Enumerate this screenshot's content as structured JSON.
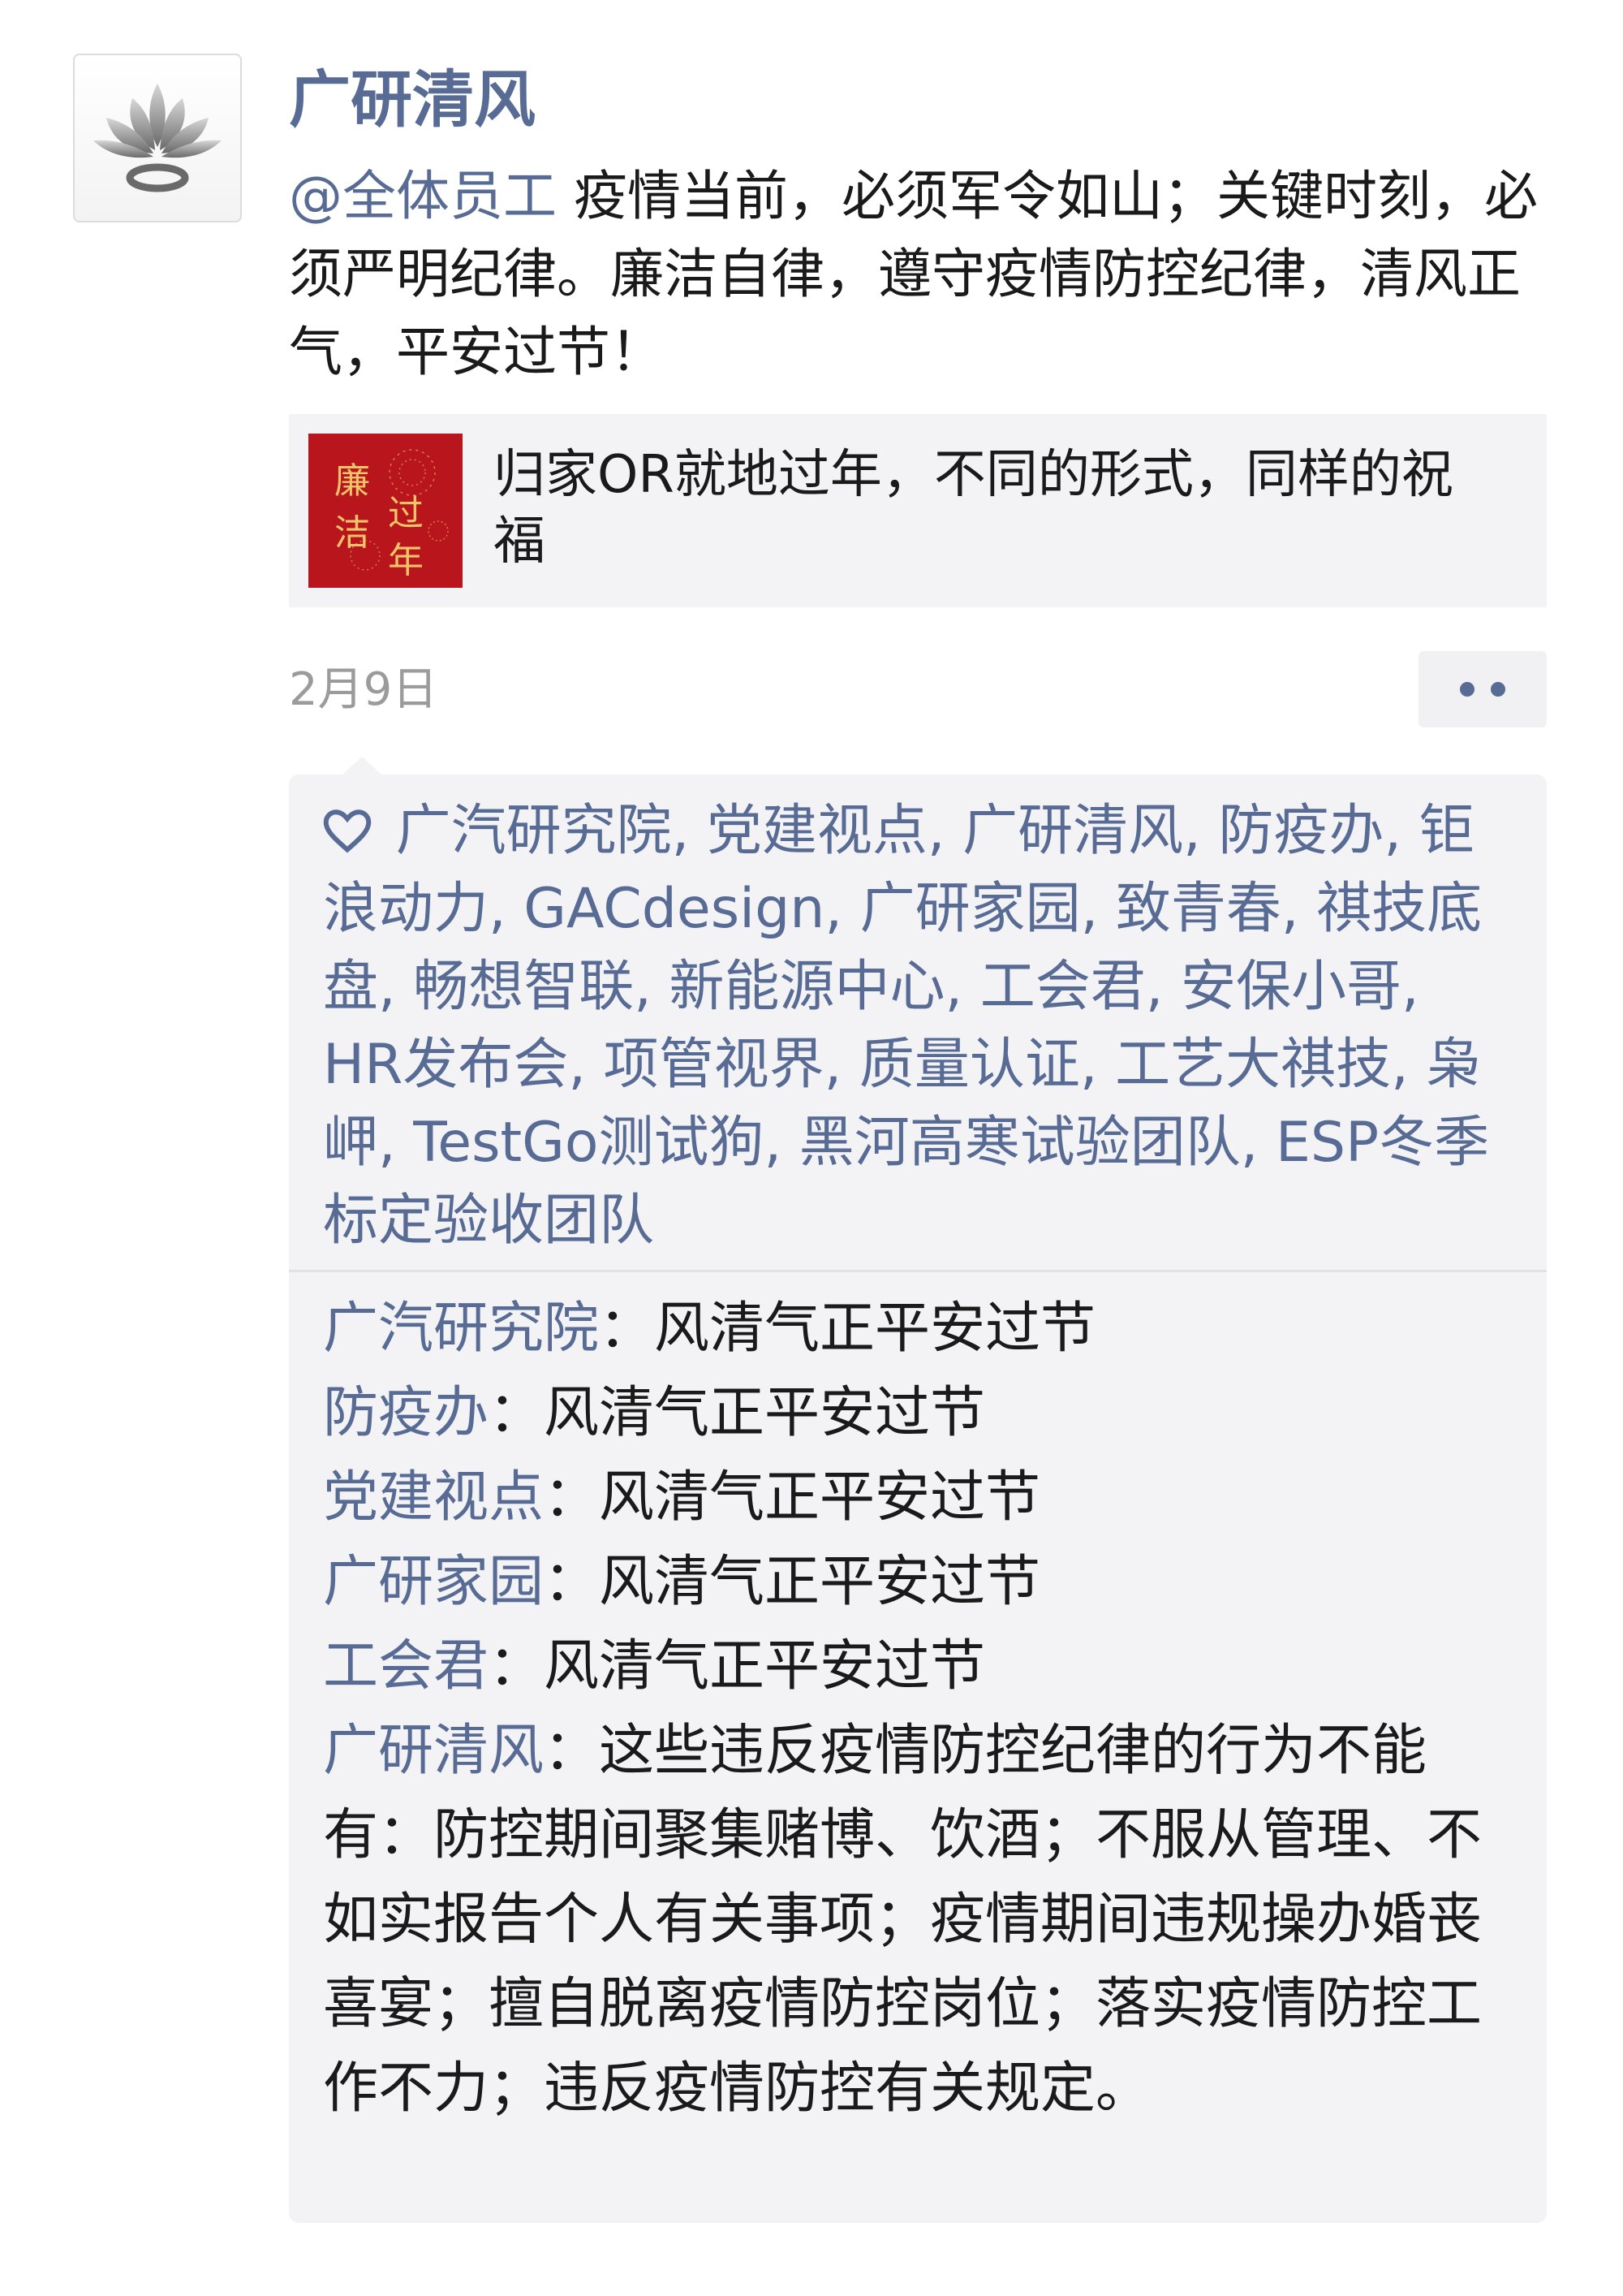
{
  "author": {
    "name": "广研清风"
  },
  "post": {
    "mention": "@全体员工",
    "text": " 疫情当前，必须军令如山；关键时刻，必须严明纪律。廉洁自律，遵守疫情防控纪律，清风正气，平安过节！"
  },
  "link_card": {
    "title": "归家OR就地过年，不同的形式，同样的祝福",
    "thumbnail_text": [
      "廉",
      "洁",
      "过",
      "年"
    ]
  },
  "meta": {
    "date": "2月9日"
  },
  "likes": {
    "icon": "heart-icon",
    "names": [
      "广汽研究院",
      "党建视点",
      "广研清风",
      "防疫办",
      "钜浪动力",
      "GACdesign",
      "广研家园",
      "致青春",
      "祺技底盘",
      "畅想智联",
      "新能源中心",
      "工会君",
      "安保小哥",
      "HR发布会",
      "项管视界",
      "质量认证",
      "工艺大祺技",
      "枭岬",
      "TestGo测试狗",
      "黑河高寒试验团队",
      "ESP冬季标定验收团队"
    ]
  },
  "comments": [
    {
      "author": "广汽研究院",
      "sep": "：",
      "text": "风清气正平安过节"
    },
    {
      "author": "防疫办",
      "sep": "：",
      "text": "风清气正平安过节"
    },
    {
      "author": "党建视点",
      "sep": "：",
      "text": "风清气正平安过节"
    },
    {
      "author": "广研家园",
      "sep": "：",
      "text": "风清气正平安过节"
    },
    {
      "author": "工会君",
      "sep": "：",
      "text": "风清气正平安过节"
    },
    {
      "author": "广研清风",
      "sep": "：",
      "text": "这些违反疫情防控纪律的行为不能有：防控期间聚集赌博、饮酒；不服从管理、不如实报告个人有关事项；疫情期间违规操办婚丧喜宴；擅自脱离疫情防控岗位；落实疫情防控工作不力；违反疫情防控有关规定。"
    }
  ],
  "colors": {
    "link": "#576b95",
    "text": "#1a1a1a",
    "muted": "#9b9b9b",
    "panel": "#f3f3f5",
    "thumb": "#b8161c"
  }
}
